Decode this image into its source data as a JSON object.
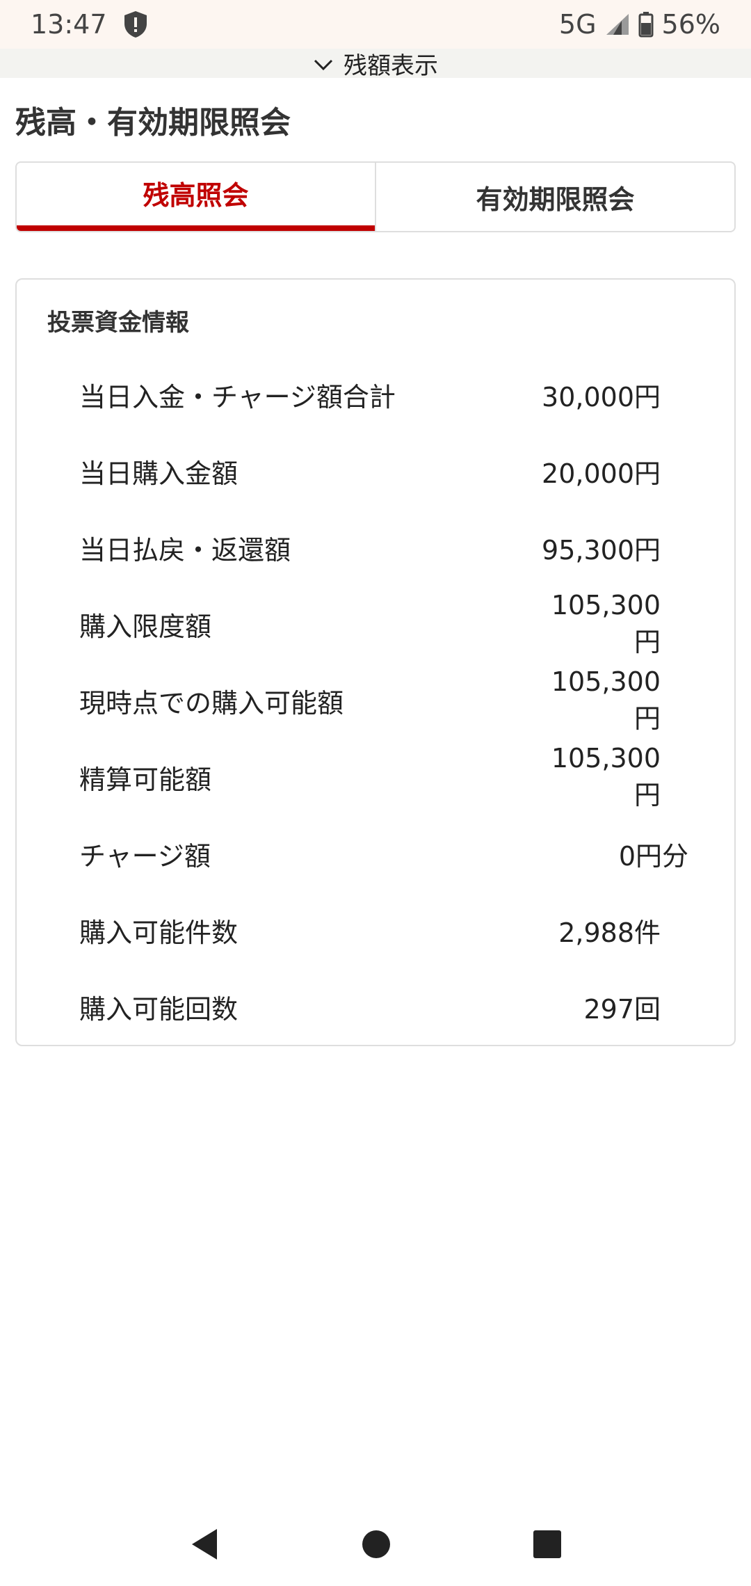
{
  "status": {
    "time": "13:47",
    "network": "5G",
    "battery": "56%"
  },
  "collapse": {
    "label": "残額表示"
  },
  "page": {
    "title": "残高・有効期限照会"
  },
  "tabs": [
    {
      "label": "残高照会",
      "active": true
    },
    {
      "label": "有効期限照会",
      "active": false
    }
  ],
  "card": {
    "title": "投票資金情報",
    "rows": [
      {
        "label": "当日入金・チャージ額合計",
        "value": "30,000円"
      },
      {
        "label": "当日購入金額",
        "value": "20,000円"
      },
      {
        "label": "当日払戻・返還額",
        "value": "95,300円"
      },
      {
        "label": "購入限度額",
        "value": "105,300円"
      },
      {
        "label": "現時点での購入可能額",
        "value": "105,300円"
      },
      {
        "label": "精算可能額",
        "value": "105,300円"
      },
      {
        "label": "チャージ額",
        "value": "0円分"
      },
      {
        "label": "購入可能件数",
        "value": "2,988件"
      },
      {
        "label": "購入可能回数",
        "value": "297回"
      }
    ]
  },
  "colors": {
    "accent": "#c00000",
    "status_bar_bg": "#fdf6f1",
    "border": "#dedede"
  }
}
